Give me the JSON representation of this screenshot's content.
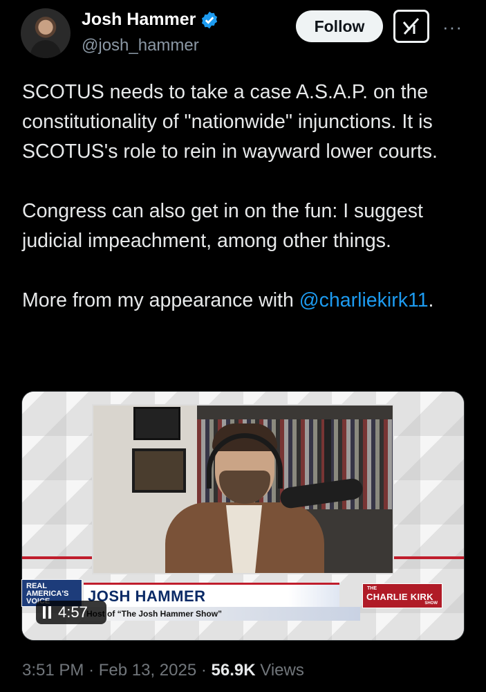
{
  "author": {
    "name": "Josh Hammer",
    "handle": "@josh_hammer",
    "verified": true
  },
  "actions": {
    "follow_label": "Follow",
    "grok_icon": "grok-icon",
    "more_icon": "more-icon"
  },
  "tweet": {
    "paragraph1": "SCOTUS needs to take a case A.S.A.P. on the constitutionality of \"nationwide\" injunctions. It is SCOTUS's role to rein in wayward lower courts.",
    "paragraph2": "Congress can also get in on the fun: I suggest judicial impeachment, among other things.",
    "paragraph3_prefix": "More from my appearance with ",
    "mention": "@charliekirk11",
    "paragraph3_suffix": "."
  },
  "video": {
    "duration": "4:57",
    "network_logo": "REAL AMERICA'S VOICE",
    "lower_third_name": "JOSH HAMMER",
    "lower_third_subtitle": "Host of “The Josh Hammer Show”",
    "show_logo_the": "THE",
    "show_logo_main": "CHARLIE KIRK",
    "show_logo_show": "SHOW"
  },
  "meta": {
    "time": "3:51 PM",
    "date": "Feb 13, 2025",
    "views_count": "56.9K",
    "views_label": "Views",
    "separator": "·"
  },
  "colors": {
    "background": "#000000",
    "link": "#1d9bf0",
    "verified_badge": "#1d9bf0",
    "secondary_text": "#71767b"
  }
}
